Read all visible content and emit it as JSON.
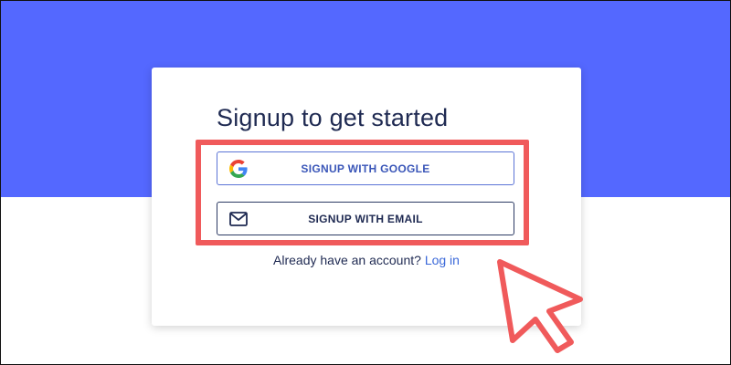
{
  "colors": {
    "brand_band": "#5468ff",
    "title_text": "#1f2a52",
    "link": "#3a68d9",
    "highlight": "#f05a5b"
  },
  "signup": {
    "title": "Signup to get started",
    "google_button": {
      "label": "SIGNUP WITH GOOGLE",
      "icon": "google-icon"
    },
    "email_button": {
      "label": "SIGNUP WITH EMAIL",
      "icon": "envelope-icon"
    },
    "footer": {
      "prompt": "Already have an account?",
      "login_link": "Log in"
    }
  },
  "annotation": {
    "highlight": "highlight-box",
    "pointer": "mouse-pointer-icon"
  }
}
